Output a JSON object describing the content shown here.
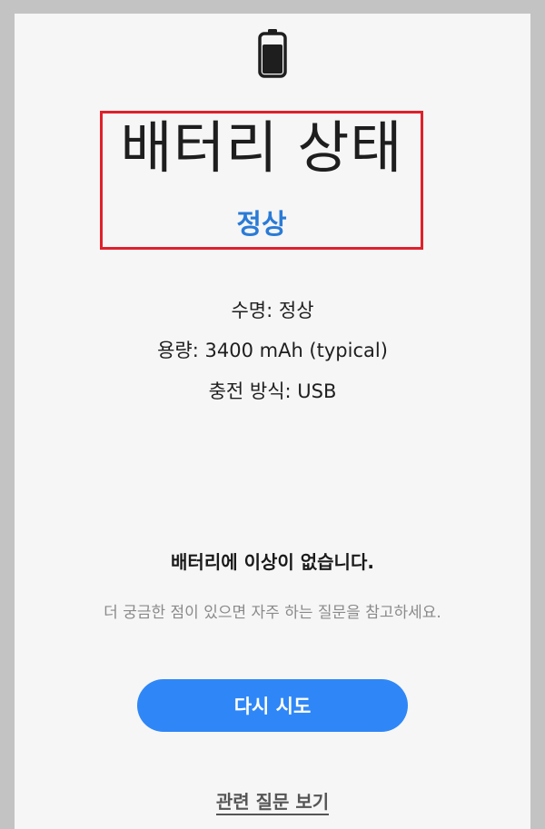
{
  "header": {
    "icon": "battery-icon",
    "title": "배터리 상태",
    "status": "정상",
    "status_color": "#2a7bd6",
    "highlight_color": "#e0202a"
  },
  "details": {
    "lifespan": "수명: 정상",
    "capacity": "용량: 3400 mAh (typical)",
    "charging_method": "충전 방식: USB"
  },
  "result": {
    "message": "배터리에 이상이 없습니다.",
    "hint": "더 궁금한 점이 있으면 자주 하는 질문을 참고하세요."
  },
  "actions": {
    "retry_label": "다시 시도",
    "retry_color": "#2f87f7",
    "related_faq_label": "관련 질문 보기"
  }
}
